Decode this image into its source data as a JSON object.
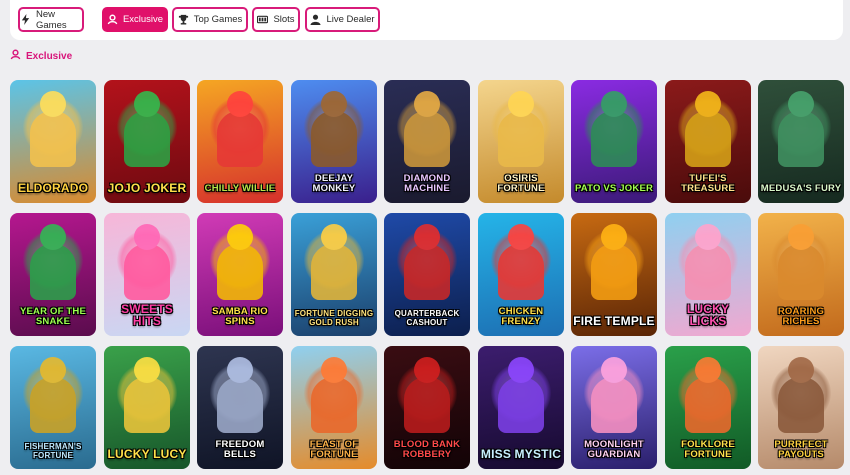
{
  "tabs": [
    {
      "label": "New Games",
      "icon": "lightning-icon",
      "active": false
    },
    {
      "label": "Exclusive",
      "icon": "exclusive-icon",
      "active": true
    },
    {
      "label": "Top Games",
      "icon": "trophy-icon",
      "active": false
    },
    {
      "label": "Slots",
      "icon": "slot-machine-icon",
      "active": false
    },
    {
      "label": "Live Dealer",
      "icon": "dealer-icon",
      "active": false
    }
  ],
  "section": {
    "title": "Exclusive",
    "icon": "exclusive-icon"
  },
  "colors": {
    "accent": "#e0106a",
    "background": "#eeeef1"
  },
  "games": [
    {
      "title": "Eldorado",
      "colors": [
        "#5bc4e8",
        "#d98a2e"
      ],
      "accent": "#f2c14e",
      "titleColor": "#ffd23f"
    },
    {
      "title": "Jojo Joker",
      "colors": [
        "#b3121b",
        "#6d0a10"
      ],
      "accent": "#2ea043",
      "titleColor": "#ffe04a"
    },
    {
      "title": "Chilly Willie",
      "colors": [
        "#f5a623",
        "#d6302c"
      ],
      "accent": "#e53935",
      "titleColor": "#b7e34a"
    },
    {
      "title": "DeeJay Monkey",
      "colors": [
        "#4e8df0",
        "#3a1f8c"
      ],
      "accent": "#8b5a2b",
      "titleColor": "#f2f2ff"
    },
    {
      "title": "Diamond Machine",
      "colors": [
        "#2a2d55",
        "#1a1a2e"
      ],
      "accent": "#c9953b",
      "titleColor": "#e8c7ff"
    },
    {
      "title": "Osiris Fortune",
      "colors": [
        "#f4d58d",
        "#c48a2c"
      ],
      "accent": "#e9b949",
      "titleColor": "#fff3c4"
    },
    {
      "title": "Pato vs Joker",
      "colors": [
        "#8a2be2",
        "#3b1a78"
      ],
      "accent": "#2e8b57",
      "titleColor": "#a3ff4f"
    },
    {
      "title": "Tufei's Treasure",
      "colors": [
        "#8b1a1a",
        "#4a0b0b"
      ],
      "accent": "#d4a017",
      "titleColor": "#ffe08a"
    },
    {
      "title": "Medusa's Fury",
      "colors": [
        "#2f4f3a",
        "#162a20"
      ],
      "accent": "#3f8f5f",
      "titleColor": "#d8f5c8"
    },
    {
      "title": "Year of the Snake",
      "colors": [
        "#b5178f",
        "#5a0c4d"
      ],
      "accent": "#2c9e4a",
      "titleColor": "#9dff4f"
    },
    {
      "title": "Sweets Hits",
      "colors": [
        "#f7b6d8",
        "#c9d7f3"
      ],
      "accent": "#ff5a9e",
      "titleColor": "#ff3ea5"
    },
    {
      "title": "Samba Rio Spins",
      "colors": [
        "#d13bb6",
        "#7a0f7a"
      ],
      "accent": "#f2b705",
      "titleColor": "#ffe14a"
    },
    {
      "title": "Fortune Digging Gold Rush",
      "colors": [
        "#3aa0d8",
        "#1b3f6b"
      ],
      "accent": "#e0b43a",
      "titleColor": "#ffe27a"
    },
    {
      "title": "Quarterback Cashout",
      "colors": [
        "#1f4aa8",
        "#0c1f4d"
      ],
      "accent": "#c62828",
      "titleColor": "#ffffff"
    },
    {
      "title": "Chicken Frenzy",
      "colors": [
        "#25b4e8",
        "#1d6fb3"
      ],
      "accent": "#e53935",
      "titleColor": "#ffe14a"
    },
    {
      "title": "Fire Temple",
      "colors": [
        "#c76a12",
        "#5a2506"
      ],
      "accent": "#f39c12",
      "titleColor": "#ffffff"
    },
    {
      "title": "Lucky Licks",
      "colors": [
        "#8fd0f0",
        "#f1a8d0"
      ],
      "accent": "#f48fb1",
      "titleColor": "#ff4fb0"
    },
    {
      "title": "Roaring Riches",
      "colors": [
        "#f2b24a",
        "#c26a1c"
      ],
      "accent": "#d98a2e",
      "titleColor": "#ff9f1c"
    },
    {
      "title": "Fisherman's Fortune",
      "colors": [
        "#5ab8e3",
        "#2a6b8f"
      ],
      "accent": "#c9a227",
      "titleColor": "#bfe9ff"
    },
    {
      "title": "Lucky Lucy",
      "colors": [
        "#3aa14a",
        "#17562a"
      ],
      "accent": "#e8c33a",
      "titleColor": "#ffe14a"
    },
    {
      "title": "Freedom Bells",
      "colors": [
        "#2e3550",
        "#0f1426"
      ],
      "accent": "#9aa7c7",
      "titleColor": "#ffffff"
    },
    {
      "title": "Feast of Fortune",
      "colors": [
        "#8fd0f0",
        "#e58b2a"
      ],
      "accent": "#e9692c",
      "titleColor": "#ffb347"
    },
    {
      "title": "Blood Bank Robbery",
      "colors": [
        "#3a0d12",
        "#120306"
      ],
      "accent": "#b71c1c",
      "titleColor": "#ff4a4a"
    },
    {
      "title": "Miss Mystic",
      "colors": [
        "#3c1d6e",
        "#160a2f"
      ],
      "accent": "#7b3fe4",
      "titleColor": "#c8f0ff"
    },
    {
      "title": "Moonlight Guardian",
      "colors": [
        "#7b6ee8",
        "#2a1f6b"
      ],
      "accent": "#f48fc1",
      "titleColor": "#ffd1f0"
    },
    {
      "title": "Folklore Fortune",
      "colors": [
        "#2aa04a",
        "#115a26"
      ],
      "accent": "#e9692c",
      "titleColor": "#ffe14a"
    },
    {
      "title": "Purrfect Payouts",
      "colors": [
        "#f0d6c0",
        "#b58a6a"
      ],
      "accent": "#8b5a3c",
      "titleColor": "#ffd23f"
    }
  ]
}
